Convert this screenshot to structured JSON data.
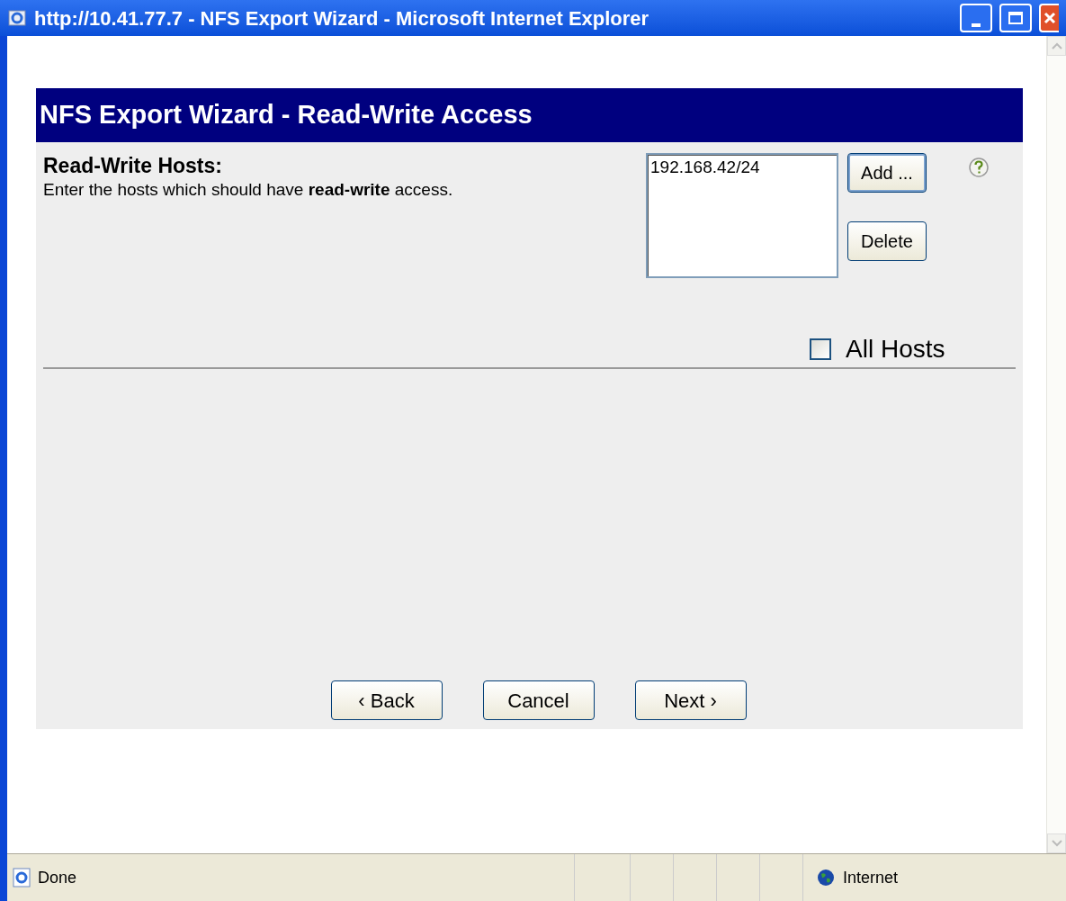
{
  "window": {
    "title": "http://10.41.77.7 - NFS Export Wizard - Microsoft Internet Explorer"
  },
  "page": {
    "header": "NFS Export Wizard - Read-Write Access",
    "section": {
      "title": "Read-Write Hosts:",
      "description": "Enter the hosts which should have **read-write** access."
    },
    "hosts": [
      {
        "label": "192.168.42/24",
        "selected": false
      }
    ],
    "host_buttons": [
      {
        "label": "Add ...",
        "focused": true
      },
      {
        "label": "Delete",
        "focused": false
      }
    ],
    "all_hosts": {
      "label": "All Hosts",
      "checked": false
    },
    "nav_buttons": [
      "‹ Back",
      "Cancel",
      "Next ›"
    ]
  },
  "status_bar": {
    "text": "Done",
    "zone": "Internet"
  }
}
